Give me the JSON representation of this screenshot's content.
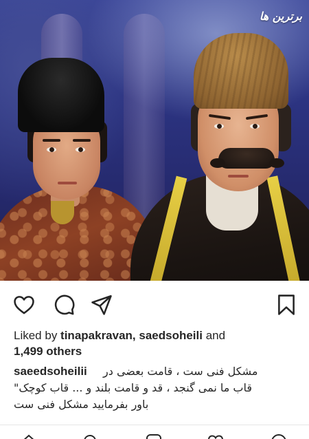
{
  "post": {
    "image_alt": "Two men in historical Persian costume",
    "watermark": "برترین ها"
  },
  "actions": {
    "like_icon": "heart-outline-icon",
    "comment_icon": "comment-bubble-icon",
    "share_icon": "paper-plane-icon",
    "save_icon": "bookmark-outline-icon"
  },
  "likes": {
    "prefix": "Liked by ",
    "users": "tinapakravan, saedsoheili",
    "joiner": " and",
    "others": "1,499 others"
  },
  "caption": {
    "username": "saeedsoheilii",
    "lines": [
      "مشکل فنی ست ، قامت بعضی در",
      "قاب ما نمی گنجد ، قد و قامت بلند و ... قاب کوچک\"",
      "باور بفرمایید مشکل فنی ست"
    ]
  },
  "tabbar": {
    "items": [
      "home-icon",
      "search-icon",
      "add-post-icon",
      "activity-heart-icon",
      "profile-icon"
    ]
  },
  "colors": {
    "text": "#262626",
    "background": "#ffffff",
    "divider": "#e5e5e5"
  }
}
